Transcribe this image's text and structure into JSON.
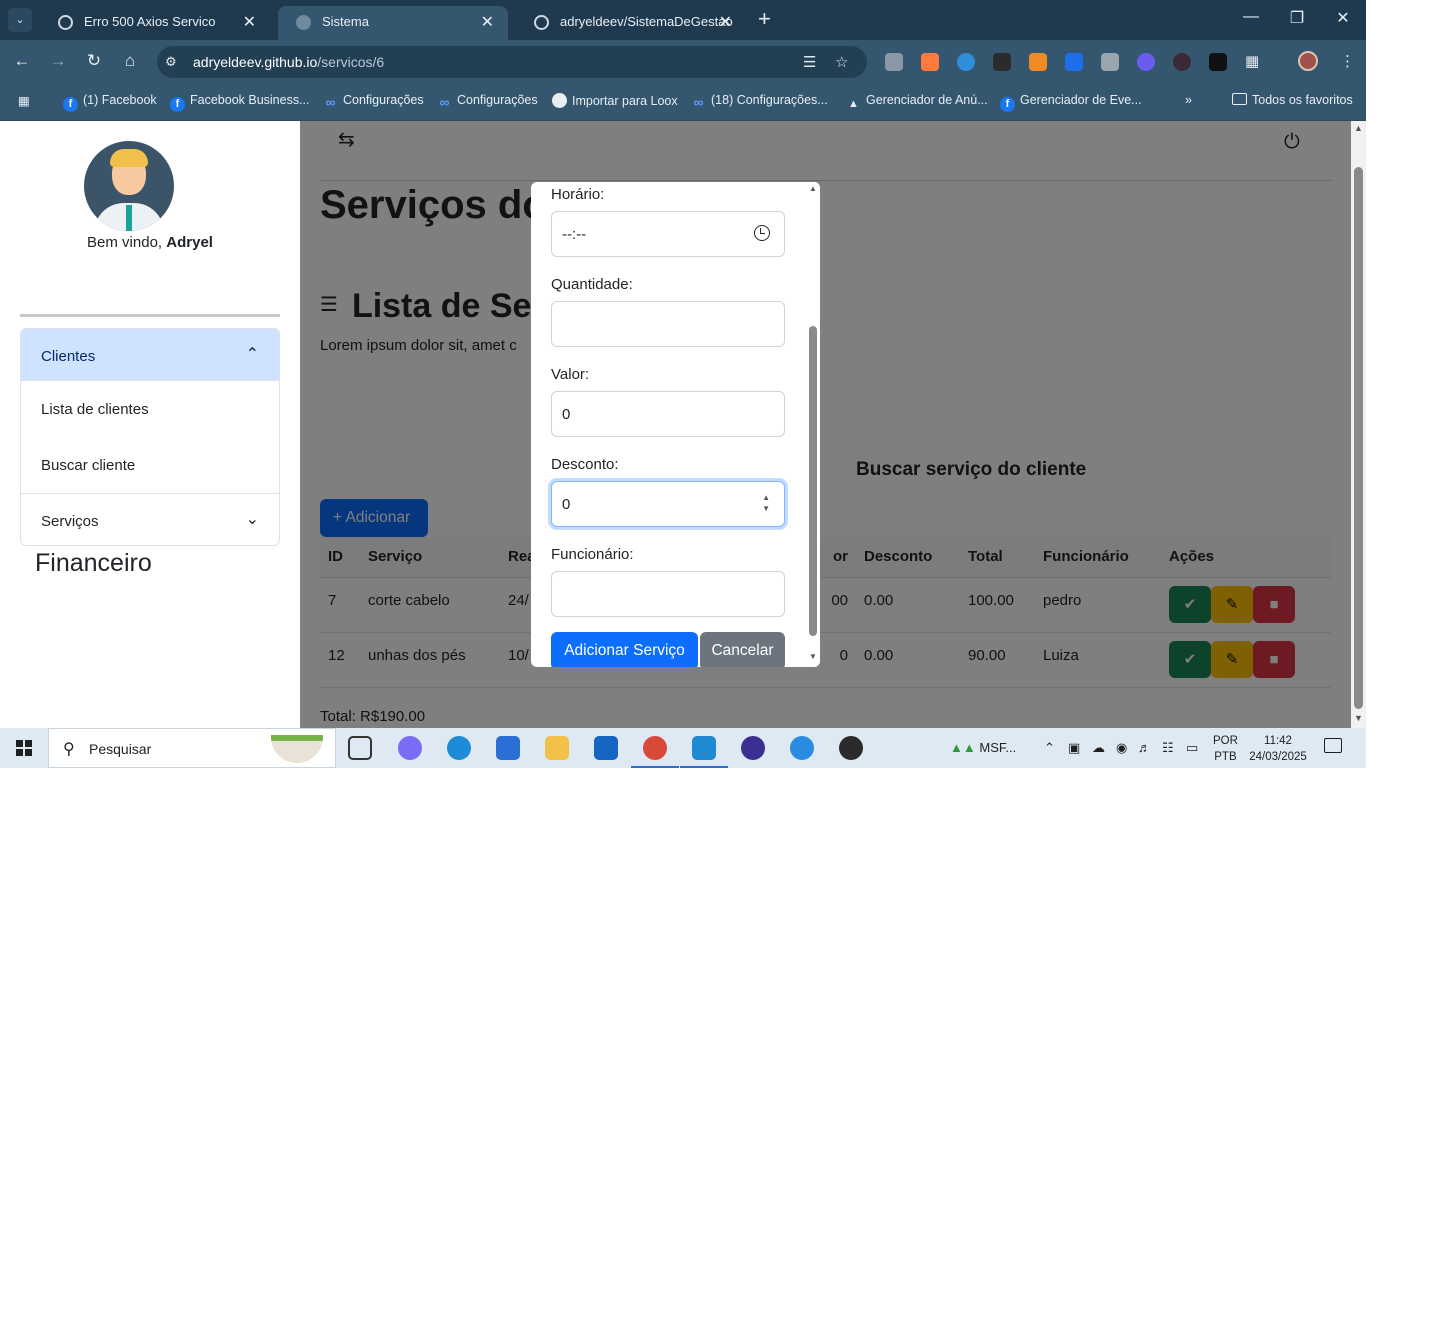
{
  "browser": {
    "tabs": [
      {
        "title": "Erro 500 Axios Servico",
        "active": false
      },
      {
        "title": "Sistema",
        "active": true
      },
      {
        "title": "adryeldeev/SistemaDeGestao",
        "active": false
      }
    ],
    "url_host": "adryeldeev.github.io",
    "url_path": "/servicos/6",
    "bookmarks": [
      "(1) Facebook",
      "Facebook Business...",
      "Configurações",
      "Configurações",
      "Importar para Loox",
      "(18) Configurações...",
      "Gerenciador de Anú...",
      "Gerenciador de Eve..."
    ],
    "all_bookmarks": "Todos os favoritos",
    "colors": {
      "frame": "#1f3a4f",
      "toolbar": "#34566f"
    }
  },
  "sidebar": {
    "welcome_prefix": "Bem vindo,",
    "user_name": "Adryel",
    "menu": {
      "clientes": "Clientes",
      "lista_clientes": "Lista de clientes",
      "buscar_cliente": "Buscar cliente",
      "servicos": "Serviços"
    },
    "financeiro": "Financeiro"
  },
  "main": {
    "title": "Serviços do",
    "list_title": "Lista de Serv",
    "lorem": "Lorem ipsum dolor sit, amet c",
    "search_title": "Buscar serviço do cliente",
    "add_button": "+ Adicionar",
    "table": {
      "headers": [
        "ID",
        "Serviço",
        "Rea",
        "or",
        "Desconto",
        "Total",
        "Funcionário",
        "Ações"
      ],
      "rows": [
        {
          "id": "7",
          "servico": "corte cabelo",
          "realizado": "24/",
          "valor": "00",
          "desconto": "0.00",
          "total": "100.00",
          "funcionario": "pedro"
        },
        {
          "id": "12",
          "servico": "unhas dos pés",
          "realizado": "10/",
          "valor": "0",
          "desconto": "0.00",
          "total": "90.00",
          "funcionario": "Luiza"
        }
      ]
    },
    "total": "Total: R$190.00"
  },
  "modal": {
    "horario_label": "Horário:",
    "horario_value": "--:--",
    "quantidade_label": "Quantidade:",
    "quantidade_value": "",
    "valor_label": "Valor:",
    "valor_value": "0",
    "desconto_label": "Desconto:",
    "desconto_value": "0",
    "funcionario_label": "Funcionário:",
    "funcionario_value": "",
    "submit_button": "Adicionar Serviço",
    "cancel_button": "Cancelar",
    "colors": {
      "primary": "#0d6efd",
      "secondary": "#6c757d"
    }
  },
  "taskbar": {
    "search_placeholder": "Pesquisar",
    "tray_app": "MSF...",
    "lang_top": "POR",
    "lang_bottom": "PTB",
    "time": "11:42",
    "date": "24/03/2025"
  }
}
